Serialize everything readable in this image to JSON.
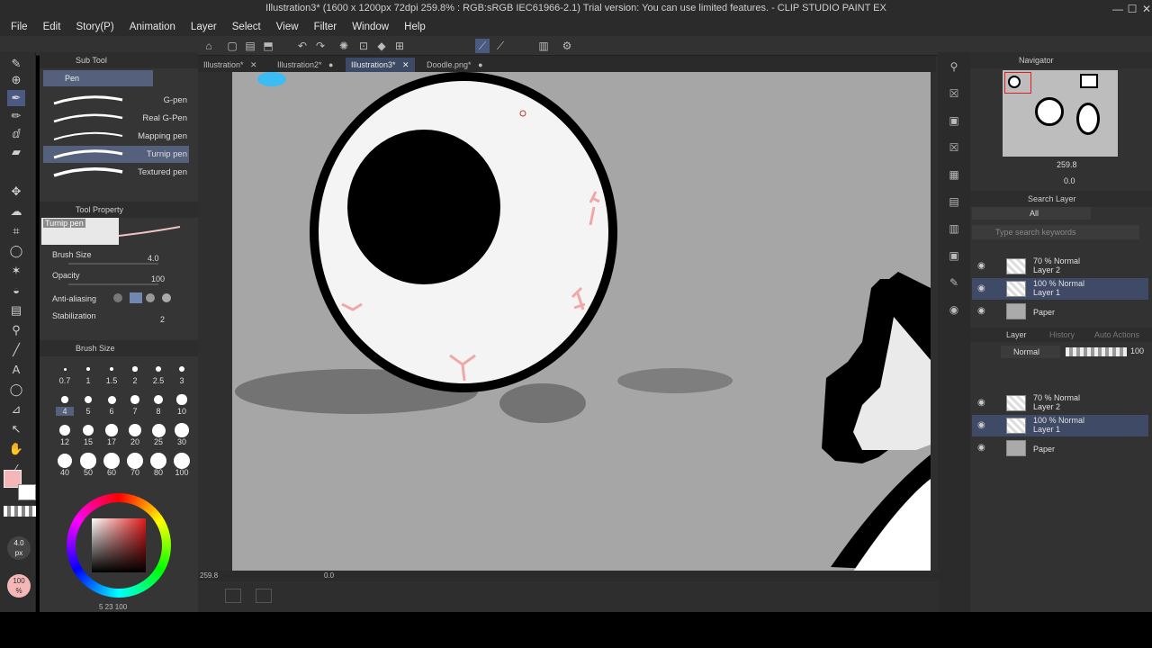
{
  "window": {
    "title": "Illustration3* (1600 x 1200px 72dpi 259.8% : RGB:sRGB IEC61966-2.1)  Trial version: You can use limited features. - CLIP STUDIO PAINT EX",
    "minimize": "—",
    "maximize": "☐",
    "close": "✕"
  },
  "menu": [
    "File",
    "Edit",
    "Story(P)",
    "Animation",
    "Layer",
    "Select",
    "View",
    "Filter",
    "Window",
    "Help"
  ],
  "tabs": [
    {
      "label": "Illustration*",
      "close": "✕"
    },
    {
      "label": "Illustration2*",
      "close": "●"
    },
    {
      "label": "Illustration3*",
      "close": "✕"
    },
    {
      "label": "Doodle.png*",
      "close": "●"
    }
  ],
  "subtool": {
    "header": "Sub Tool",
    "group": "Pen",
    "brushes": [
      "G-pen",
      "Real G-Pen",
      "Mapping pen",
      "Turnip pen",
      "Textured pen"
    ],
    "selected_brush": "Turnip pen"
  },
  "tool_property": {
    "header": "Tool Property",
    "preview_label": "Turnip pen",
    "brush_size_label": "Brush Size",
    "brush_size_value": "4.0",
    "opacity_label": "Opacity",
    "opacity_value": "100",
    "antialias_label": "Anti-aliasing",
    "stabilization_label": "Stabilization",
    "stabilization_value": "2"
  },
  "brush_size_panel": {
    "header": "Brush Size",
    "rows": [
      [
        "0.7",
        "1",
        "1.5",
        "2",
        "2.5",
        "3"
      ],
      [
        "4",
        "5",
        "6",
        "7",
        "8",
        "10"
      ],
      [
        "12",
        "15",
        "17",
        "20",
        "25",
        "30"
      ],
      [
        "40",
        "50",
        "60",
        "70",
        "80",
        "100"
      ]
    ]
  },
  "left_bottom": {
    "size_value": "4.0",
    "size_unit": "px",
    "opacity_value": "100",
    "opacity_unit": "%",
    "bottom_readout": "5  23  100",
    "main_color": "#f4b6b6",
    "sub_color": "#ffffff"
  },
  "navigator": {
    "header": "Navigator",
    "zoom": "259.8",
    "rotation": "0.0"
  },
  "search_layer": {
    "header": "Search Layer",
    "filter": "All",
    "placeholder": "Type search keywords"
  },
  "layers_top": [
    {
      "mode": "70 % Normal",
      "name": "Layer 2",
      "selected": false
    },
    {
      "mode": "100 % Normal",
      "name": "Layer 1",
      "selected": true
    },
    {
      "mode": "",
      "name": "Paper",
      "selected": false
    }
  ],
  "layer_panel": {
    "tab_layer": "Layer",
    "tab_history": "History",
    "tab_auto": "Auto Actions",
    "blend_mode": "Normal",
    "opacity": "100"
  },
  "layers_bottom": [
    {
      "mode": "70 % Normal",
      "name": "Layer 2",
      "selected": false
    },
    {
      "mode": "100 % Normal",
      "name": "Layer 1",
      "selected": true
    },
    {
      "mode": "",
      "name": "Paper",
      "selected": false
    }
  ],
  "status": {
    "zoom": "259.8",
    "angle": "0.0"
  },
  "colors": {
    "accent": "#3e4a66",
    "canvas_bg": "#a6a6a6",
    "selection": "#55617c"
  }
}
